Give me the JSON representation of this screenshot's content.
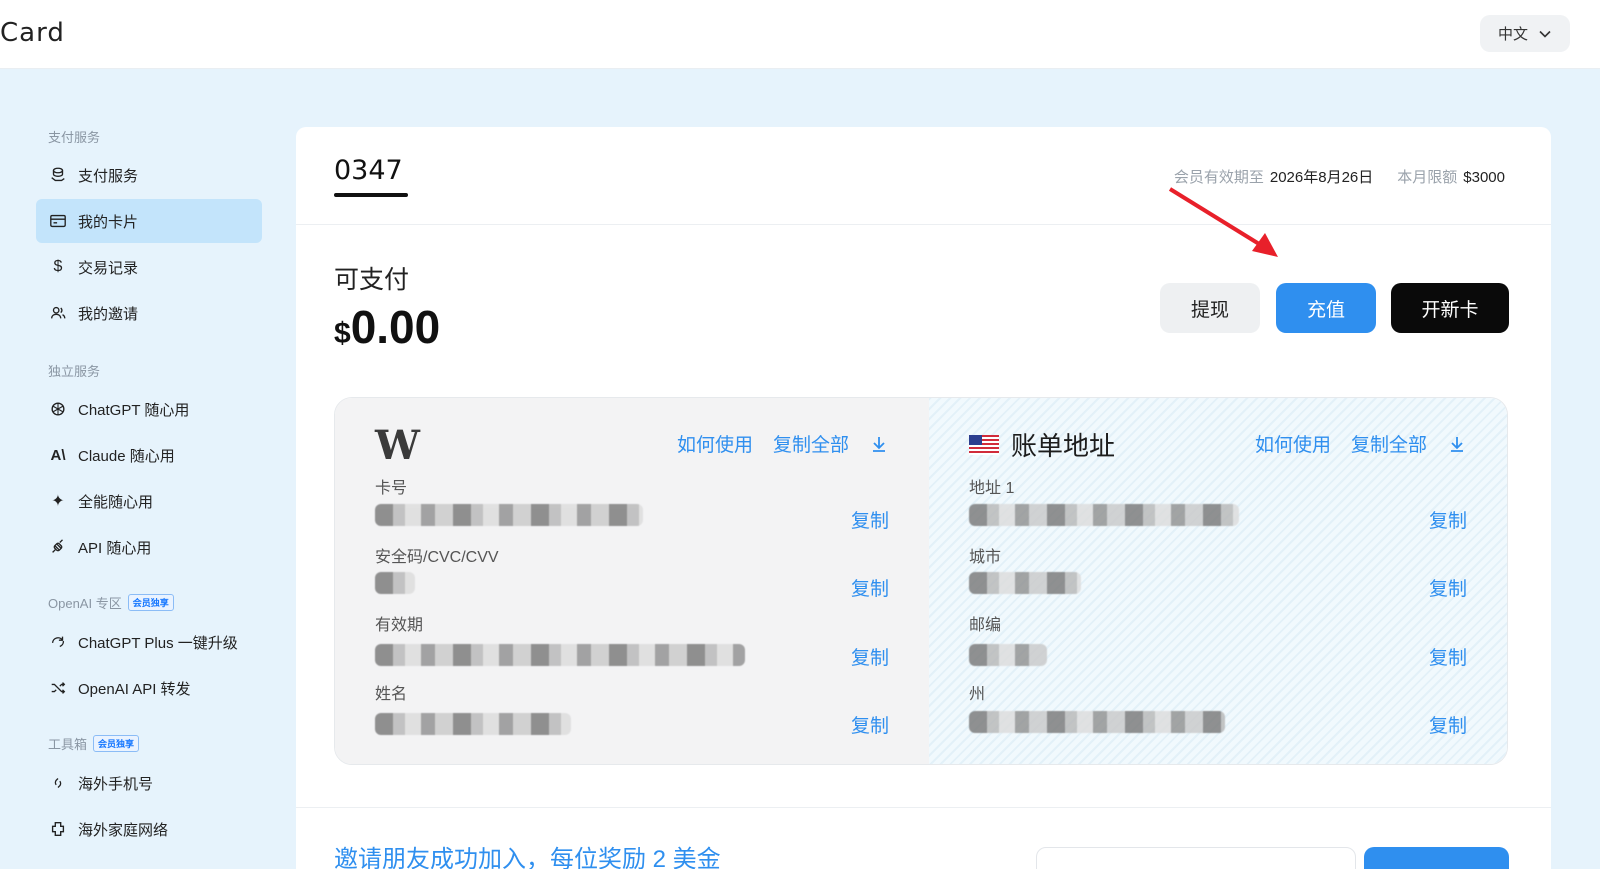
{
  "app": {
    "brand": "Card",
    "language": "中文"
  },
  "sidebar": {
    "sections": [
      {
        "title": "支付服务",
        "member_tag": ""
      },
      {
        "title": "独立服务",
        "member_tag": ""
      },
      {
        "title": "OpenAI 专区",
        "member_tag": "会员独享"
      },
      {
        "title": "工具箱",
        "member_tag": "会员独享"
      }
    ],
    "items": [
      {
        "label": "支付服务",
        "icon": "coins-icon"
      },
      {
        "label": "我的卡片",
        "icon": "card-icon",
        "active": true
      },
      {
        "label": "交易记录",
        "icon": "dollar-icon"
      },
      {
        "label": "我的邀请",
        "icon": "users-icon"
      },
      {
        "label": "ChatGPT 随心用",
        "icon": "openai-icon"
      },
      {
        "label": "Claude 随心用",
        "icon": "anthropic-icon"
      },
      {
        "label": "全能随心用",
        "icon": "sparkle-icon"
      },
      {
        "label": "API 随心用",
        "icon": "plug-icon"
      },
      {
        "label": "ChatGPT Plus 一键升级",
        "icon": "upgrade-icon"
      },
      {
        "label": "OpenAI API 转发",
        "icon": "shuffle-icon"
      },
      {
        "label": "海外手机号",
        "icon": "phone-icon"
      },
      {
        "label": "海外家庭网络",
        "icon": "network-icon"
      }
    ]
  },
  "main": {
    "card_tab": "0347",
    "validity_label": "会员有效期至",
    "validity_value": "2026年8月26日",
    "limit_label": "本月限额",
    "limit_value": "$3000",
    "pay_label": "可支付",
    "currency": "$",
    "balance": "0.00",
    "buttons": {
      "withdraw": "提现",
      "topup": "充值",
      "new_card": "开新卡"
    },
    "card_panel": {
      "logo": "W",
      "how_to_use": "如何使用",
      "copy_all": "复制全部",
      "fields": [
        {
          "label": "卡号",
          "copy": "复制"
        },
        {
          "label": "安全码/CVC/CVV",
          "copy": "复制"
        },
        {
          "label": "有效期",
          "copy": "复制"
        },
        {
          "label": "姓名",
          "copy": "复制"
        }
      ]
    },
    "billing_panel": {
      "title": "账单地址",
      "how_to_use": "如何使用",
      "copy_all": "复制全部",
      "fields": [
        {
          "label": "地址 1",
          "copy": "复制"
        },
        {
          "label": "城市",
          "copy": "复制"
        },
        {
          "label": "邮编",
          "copy": "复制"
        },
        {
          "label": "州",
          "copy": "复制"
        }
      ]
    },
    "invite_banner": "邀请朋友成功加入，每位奖励 2 美金"
  },
  "colors": {
    "accent": "#2f8fef",
    "active_nav": "#c3e4fb",
    "background": "#e6f3fc",
    "arrow": "#e8202a"
  }
}
